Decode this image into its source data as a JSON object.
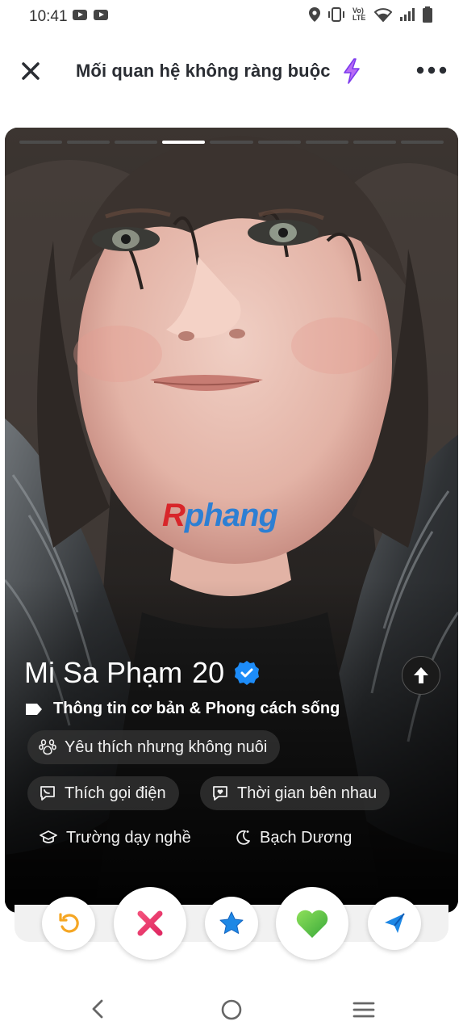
{
  "status_bar": {
    "time": "10:41",
    "icons": [
      "youtube-icon",
      "youtube-icon",
      "location-icon",
      "vibrate-icon",
      "volte-icon",
      "wifi-icon",
      "signal-icon",
      "battery-icon"
    ],
    "volte_text": "Vo) LTE"
  },
  "header": {
    "title": "Mối quan hệ không ràng buộc",
    "title_icon": "lightning-icon",
    "accent_color": "#a855f7"
  },
  "card": {
    "photo_count": 9,
    "active_photo": 4,
    "watermark": {
      "part_a": "R",
      "part_b": "phang"
    },
    "name": "Mi Sa Phạm",
    "age": "20",
    "verified": true,
    "info_label": "Thông tin cơ bản & Phong cách sống",
    "chips": [
      {
        "icon": "paw-icon",
        "label": "Yêu thích nhưng không nuôi"
      },
      {
        "icon": "chat-phone-icon",
        "label": "Thích gọi điện"
      },
      {
        "icon": "chat-heart-icon",
        "label": "Thời gian bên nhau"
      },
      {
        "icon": "graduation-cap-icon",
        "label": "Trường dạy nghề"
      },
      {
        "icon": "moon-icon",
        "label": "Bạch Dương"
      }
    ]
  },
  "actions": [
    {
      "name": "rewind",
      "icon": "rewind-icon",
      "color": "#f5a623"
    },
    {
      "name": "nope",
      "icon": "x-icon",
      "color": "#e8337a"
    },
    {
      "name": "super-like",
      "icon": "star-icon",
      "color": "#1e88e5"
    },
    {
      "name": "like",
      "icon": "heart-icon",
      "color": "#5cc23f"
    },
    {
      "name": "boost",
      "icon": "send-icon",
      "color": "#1e88e5"
    }
  ],
  "nav": [
    "back-icon",
    "home-icon",
    "recents-icon"
  ]
}
